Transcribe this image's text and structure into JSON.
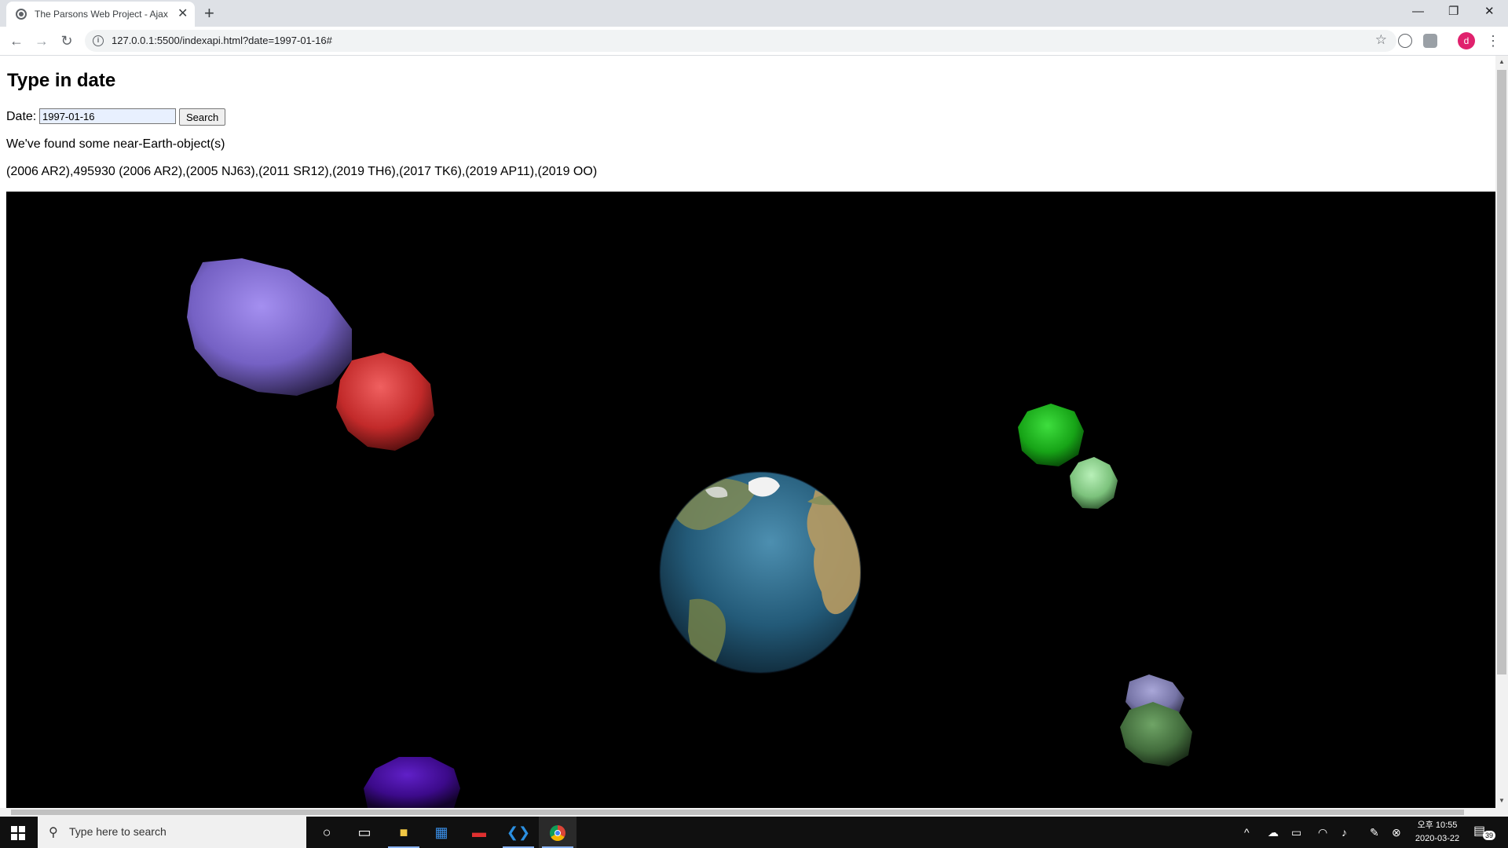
{
  "browser": {
    "tab_title": "The Parsons Web Project - Ajax",
    "tab_close": "✕",
    "new_tab": "+",
    "url": "127.0.0.1:5500/indexapi.html?date=1997-01-16#",
    "avatar_letter": "d",
    "window_controls": {
      "minimize": "—",
      "restore": "❐",
      "close": "✕"
    }
  },
  "page": {
    "heading": "Type in date",
    "date_label": "Date:",
    "date_value": "1997-01-16",
    "search_label": "Search",
    "found_text": "We've found some near-Earth-object(s)",
    "neo_list": "(2006 AR2),495930 (2006 AR2),(2005 NJ63),(2011 SR12),(2019 TH6),(2017 TK6),(2019 AP11),(2019 OO)"
  },
  "taskbar": {
    "search_placeholder": "Type here to search",
    "clock_time": "오후 10:55",
    "clock_date": "2020-03-22",
    "notification_count": "39"
  },
  "scene": {
    "objects": [
      {
        "name": "asteroid-purple-large",
        "color": "#8a75d8"
      },
      {
        "name": "asteroid-red",
        "color": "#d23a3a"
      },
      {
        "name": "asteroid-green-bright",
        "color": "#1fb21f"
      },
      {
        "name": "asteroid-green-light",
        "color": "#8fd48f"
      },
      {
        "name": "asteroid-lavender",
        "color": "#8a88b8"
      },
      {
        "name": "asteroid-green-dark",
        "color": "#4a7a45"
      },
      {
        "name": "asteroid-violet",
        "color": "#4a0fa0"
      },
      {
        "name": "earth",
        "color": "#2a6a8a"
      }
    ]
  }
}
